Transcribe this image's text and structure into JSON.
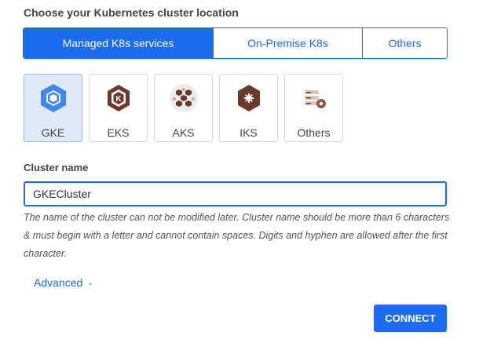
{
  "section_title": "Choose your Kubernetes cluster location",
  "location_tabs": [
    {
      "label": "Managed K8s services",
      "active": true
    },
    {
      "label": "On-Premise K8s",
      "active": false
    },
    {
      "label": "Others",
      "active": false
    }
  ],
  "providers": [
    {
      "label": "GKE",
      "icon": "gke-icon",
      "active": true
    },
    {
      "label": "EKS",
      "icon": "eks-icon",
      "active": false
    },
    {
      "label": "AKS",
      "icon": "aks-icon",
      "active": false
    },
    {
      "label": "IKS",
      "icon": "iks-icon",
      "active": false
    },
    {
      "label": "Others",
      "icon": "others-icon",
      "active": false
    }
  ],
  "cluster_name": {
    "label": "Cluster name",
    "value": "GKECluster",
    "help": "The name of the cluster can not be modified later. Cluster name should be more than 6 characters & must begin with a letter and cannot contain spaces. Digits and hyphen are allowed after the first character."
  },
  "advanced_label": "Advanced",
  "connect_label": "CONNECT",
  "colors": {
    "accent": "#1c6cf0",
    "selected_bg": "#dfeaf8"
  }
}
